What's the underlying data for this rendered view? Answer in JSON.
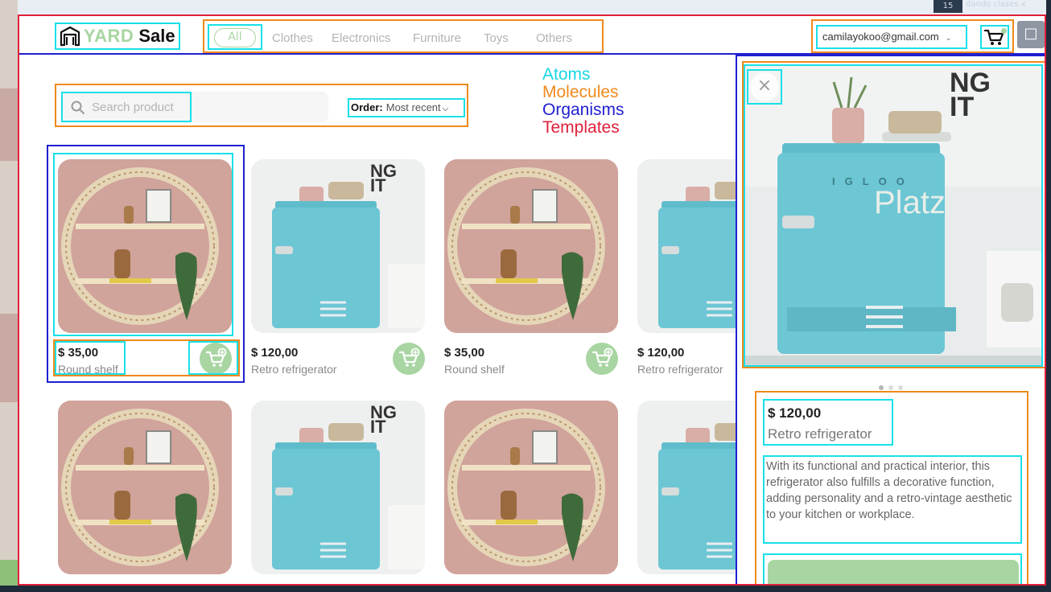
{
  "overlay": {
    "badge": "15",
    "top_right_text": "dando clases x"
  },
  "header": {
    "logo": {
      "yard": "YARD",
      "sale": "Sale"
    },
    "nav": [
      "All",
      "Clothes",
      "Electronics",
      "Furniture",
      "Toys",
      "Others"
    ],
    "email": "camilayokoo@gmail.com"
  },
  "search": {
    "placeholder": "Search product",
    "order_label": "Order:",
    "order_value": "Most recent"
  },
  "legend": [
    {
      "label": "Atoms",
      "color": "#18d6e3"
    },
    {
      "label": "Molecules",
      "color": "#f08a1c"
    },
    {
      "label": "Organisms",
      "color": "#1f1fd0"
    },
    {
      "label": "Templates",
      "color": "#e0203a"
    }
  ],
  "products": [
    {
      "price": "$ 35,00",
      "name": "Round shelf",
      "image": "shelf"
    },
    {
      "price": "$ 120,00",
      "name": "Retro refrigerator",
      "image": "fridge"
    },
    {
      "price": "$ 35,00",
      "name": "Round shelf",
      "image": "shelf"
    },
    {
      "price": "$ 120,00",
      "name": "Retro refrigerator",
      "image": "fridge"
    },
    {
      "image": "shelf"
    },
    {
      "image": "fridge"
    },
    {
      "image": "shelf"
    },
    {
      "image": "fridge"
    }
  ],
  "detail": {
    "price": "$ 120,00",
    "name": "Retro refrigerator",
    "description": "With its functional and practical interior, this refrigerator also fulfills a decorative function, adding personality and a retro-vintage aesthetic to your kitchen or workplace.",
    "image_brand": "IGLOO",
    "carousel_dots": 3,
    "carousel_active": 1
  },
  "watermark": "Platzi",
  "colors": {
    "accent_green": "#a8d5a2",
    "atoms": "#18e0e8",
    "molecules": "#f08a1c",
    "organisms": "#1f1fd0",
    "templates": "#e0203a"
  }
}
